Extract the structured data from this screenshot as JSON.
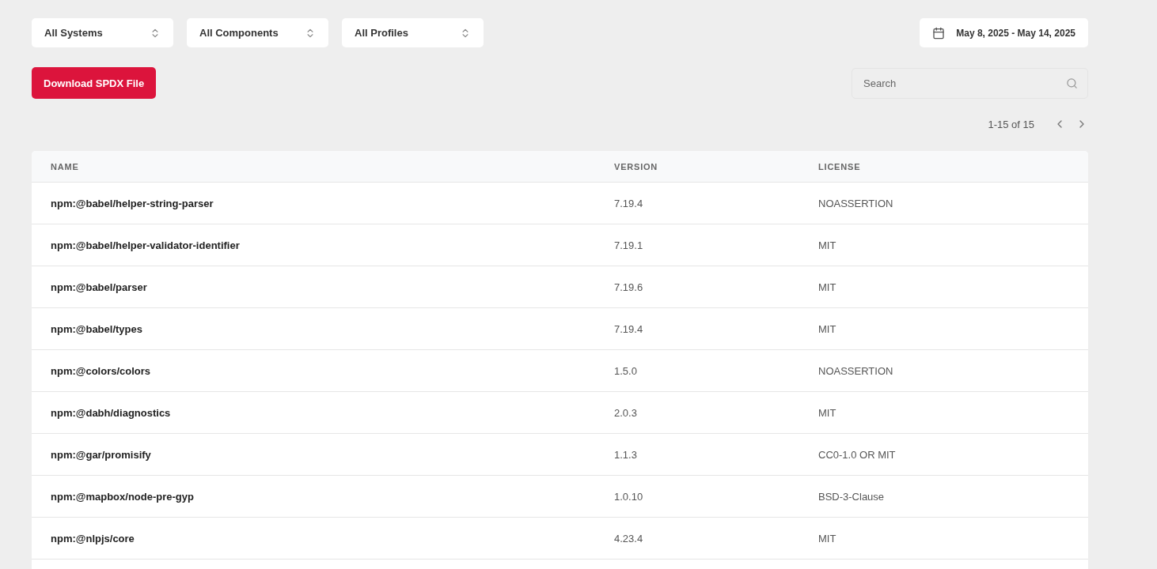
{
  "filters": [
    {
      "label": "All Systems"
    },
    {
      "label": "All Components"
    },
    {
      "label": "All Profiles"
    }
  ],
  "date_range": {
    "label": "May 8, 2025 - May 14, 2025"
  },
  "download_button": {
    "label": "Download SPDX File"
  },
  "search": {
    "placeholder": "Search"
  },
  "pagination": {
    "range": "1-15 of 15"
  },
  "table": {
    "columns": [
      "NAME",
      "VERSION",
      "LICENSE"
    ],
    "rows": [
      {
        "name": "npm:@babel/helper-string-parser",
        "version": "7.19.4",
        "license": "NOASSERTION"
      },
      {
        "name": "npm:@babel/helper-validator-identifier",
        "version": "7.19.1",
        "license": "MIT"
      },
      {
        "name": "npm:@babel/parser",
        "version": "7.19.6",
        "license": "MIT"
      },
      {
        "name": "npm:@babel/types",
        "version": "7.19.4",
        "license": "MIT"
      },
      {
        "name": "npm:@colors/colors",
        "version": "1.5.0",
        "license": "NOASSERTION"
      },
      {
        "name": "npm:@dabh/diagnostics",
        "version": "2.0.3",
        "license": "MIT"
      },
      {
        "name": "npm:@gar/promisify",
        "version": "1.1.3",
        "license": "CC0-1.0 OR MIT"
      },
      {
        "name": "npm:@mapbox/node-pre-gyp",
        "version": "1.0.10",
        "license": "BSD-3-Clause"
      },
      {
        "name": "npm:@nlpjs/core",
        "version": "4.23.4",
        "license": "MIT"
      }
    ]
  }
}
